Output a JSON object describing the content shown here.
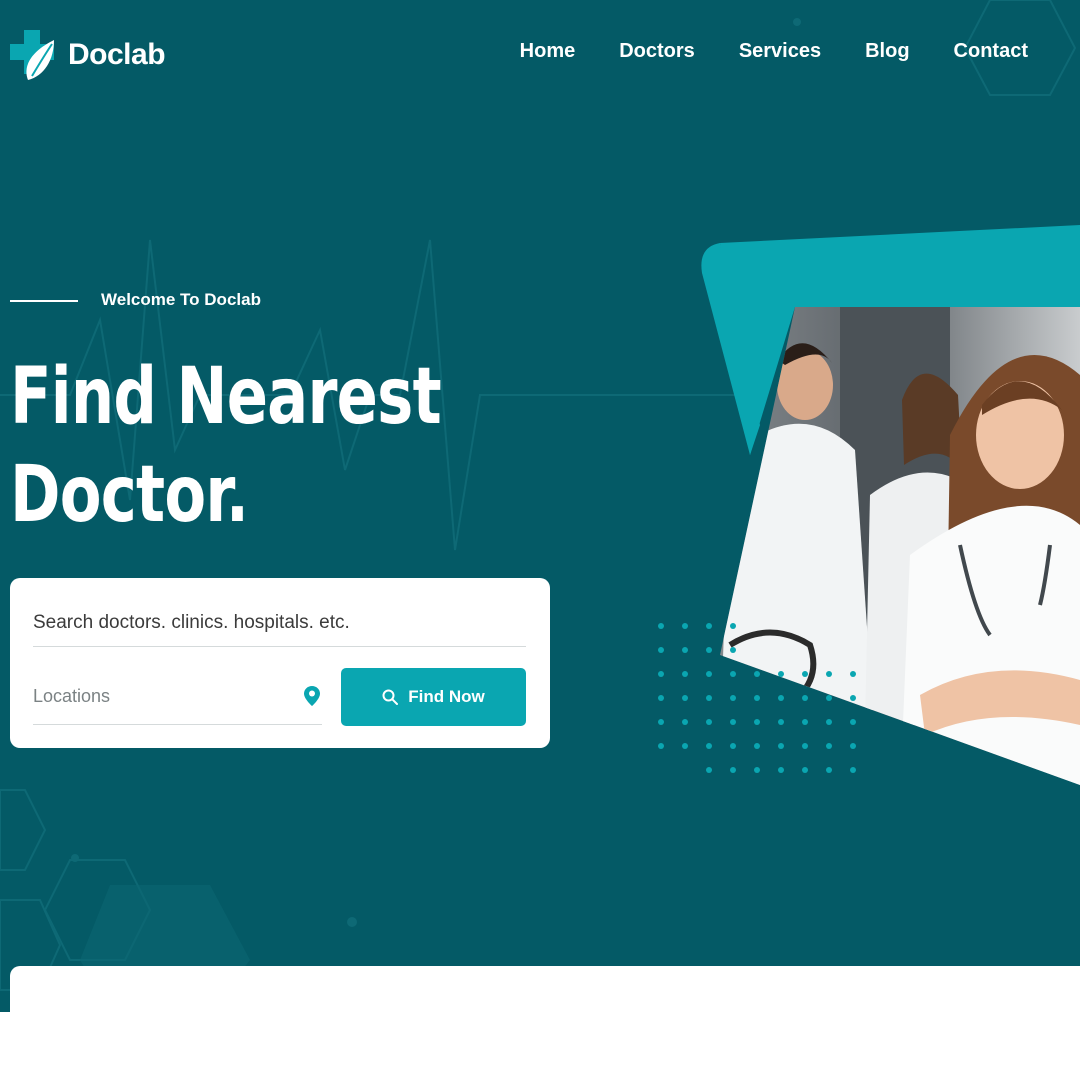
{
  "header": {
    "logo_text": "Doclab",
    "nav": [
      "Home",
      "Doctors",
      "Services",
      "Blog",
      "Contact"
    ]
  },
  "hero": {
    "welcome": "Welcome To Doclab",
    "headline_line1": "Find Nearest",
    "headline_line2": "Doctor."
  },
  "search": {
    "query_placeholder": "Search doctors. clinics. hospitals. etc.",
    "location_placeholder": "Locations",
    "button_label": "Find Now"
  },
  "colors": {
    "background": "#045a66",
    "accent": "#0aa6b1",
    "text": "#ffffff"
  },
  "icons": [
    "logo-cross-leaf-icon",
    "location-pin-icon",
    "search-icon"
  ]
}
